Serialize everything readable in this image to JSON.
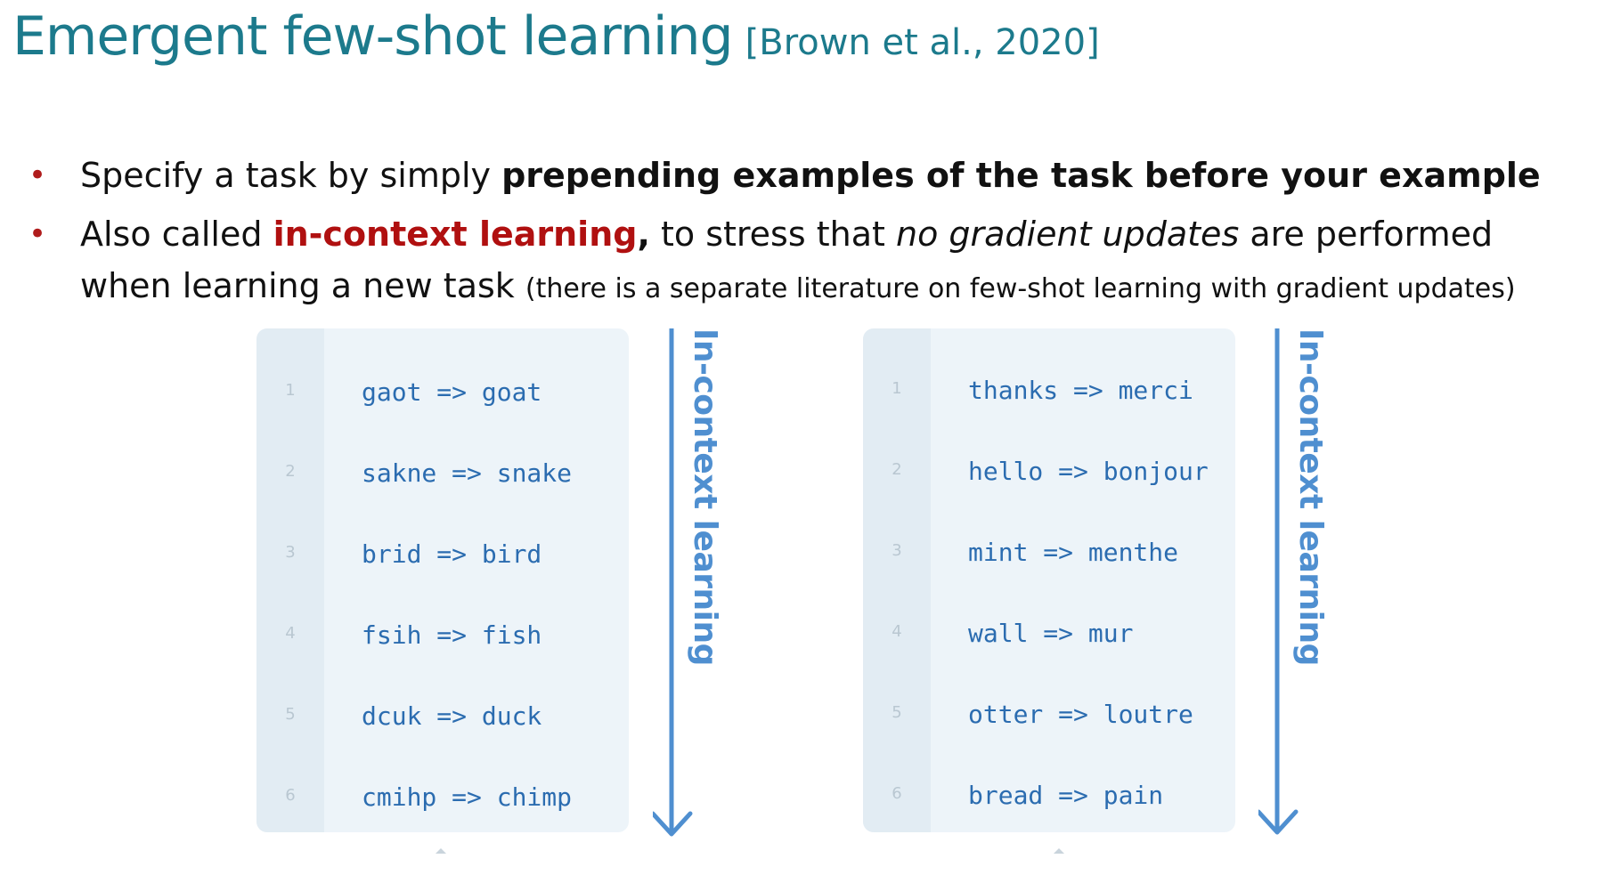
{
  "title": {
    "main": "Emergent few-shot learning",
    "cite": "[Brown et al., 2020]"
  },
  "bullets": {
    "b1": {
      "pre": "Specify a task by simply ",
      "bold": "prepending examples of the task before your example"
    },
    "b2": {
      "pre": "Also called ",
      "red": "in-context learning",
      "comma": ",",
      "mid": " to stress that ",
      "italic": "no gradient updates",
      "post": " are performed when learning a new task ",
      "small": "(there is a separate literature on few-shot learning with gradient updates)"
    }
  },
  "panels": [
    {
      "label": "In-context learning",
      "lines": [
        {
          "n": "1",
          "code": "gaot => goat"
        },
        {
          "n": "2",
          "code": "sakne => snake"
        },
        {
          "n": "3",
          "code": "brid => bird"
        },
        {
          "n": "4",
          "code": "fsih => fish"
        },
        {
          "n": "5",
          "code": "dcuk => duck"
        },
        {
          "n": "6",
          "code": "cmihp => chimp"
        }
      ]
    },
    {
      "label": "In-context learning",
      "lines": [
        {
          "n": "1",
          "code": "thanks => merci"
        },
        {
          "n": "2",
          "code": "hello => bonjour"
        },
        {
          "n": "3",
          "code": "mint => menthe"
        },
        {
          "n": "4",
          "code": "wall => mur"
        },
        {
          "n": "5",
          "code": "otter => loutre"
        },
        {
          "n": "6",
          "code": "bread => pain"
        }
      ]
    }
  ],
  "colors": {
    "title": "#1c7a8c",
    "bullet_dot": "#b01c1c",
    "highlight_red": "#b01010",
    "code_text": "#2b6cb0",
    "arrow": "#4f8fd0",
    "panel_bg": "#edf4f9",
    "gutter_bg": "#e2ecf3"
  }
}
